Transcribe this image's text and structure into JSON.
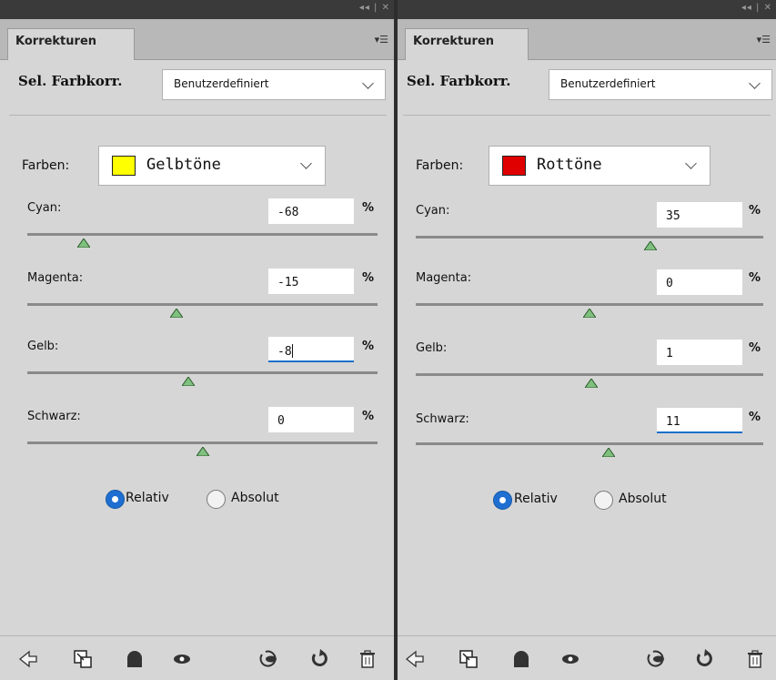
{
  "panels": [
    {
      "window_controls": "◂◂ | ✕",
      "tab_label": "Korrekturen",
      "adjustment_label": "Sel. Farbkorr.",
      "preset": {
        "value": "Benutzerdefiniert"
      },
      "farben": {
        "label": "Farben:",
        "value": "Gelbtöne",
        "swatch_color": "#ffff00"
      },
      "sliders": [
        {
          "label": "Cyan:",
          "value": "-68",
          "unit": "%",
          "amount": -68,
          "focused": false
        },
        {
          "label": "Magenta:",
          "value": "-15",
          "unit": "%",
          "amount": -15,
          "focused": false
        },
        {
          "label": "Gelb:",
          "value": "-8",
          "unit": "%",
          "amount": -8,
          "focused": true
        },
        {
          "label": "Schwarz:",
          "value": "0",
          "unit": "%",
          "amount": 0,
          "focused": false
        }
      ],
      "mode": {
        "options": [
          "Relativ",
          "Absolut"
        ],
        "selected": "Relativ"
      },
      "footer_icons": [
        "back-arrow-icon",
        "clip-to-layer-icon",
        "visibility-toggle-icon",
        "view-previous-icon",
        "reset-to-previous-icon",
        "reset-icon",
        "trash-icon"
      ]
    },
    {
      "window_controls": "◂◂ | ✕",
      "tab_label": "Korrekturen",
      "adjustment_label": "Sel. Farbkorr.",
      "preset": {
        "value": "Benutzerdefiniert"
      },
      "farben": {
        "label": "Farben:",
        "value": "Rottöne",
        "swatch_color": "#e00000"
      },
      "sliders": [
        {
          "label": "Cyan:",
          "value": "35",
          "unit": "%",
          "amount": 35,
          "focused": false
        },
        {
          "label": "Magenta:",
          "value": "0",
          "unit": "%",
          "amount": 0,
          "focused": false
        },
        {
          "label": "Gelb:",
          "value": "1",
          "unit": "%",
          "amount": 1,
          "focused": false
        },
        {
          "label": "Schwarz:",
          "value": "11",
          "unit": "%",
          "amount": 11,
          "focused": true
        }
      ],
      "mode": {
        "options": [
          "Relativ",
          "Absolut"
        ],
        "selected": "Relativ"
      },
      "footer_icons": [
        "back-arrow-icon",
        "clip-to-layer-icon",
        "visibility-toggle-icon",
        "view-previous-icon",
        "reset-to-previous-icon",
        "reset-icon",
        "trash-icon"
      ]
    }
  ],
  "colors": {
    "accent": "#1e6fd1",
    "panel_bg": "#d6d6d6",
    "slider_thumb": "#7fc07f"
  }
}
